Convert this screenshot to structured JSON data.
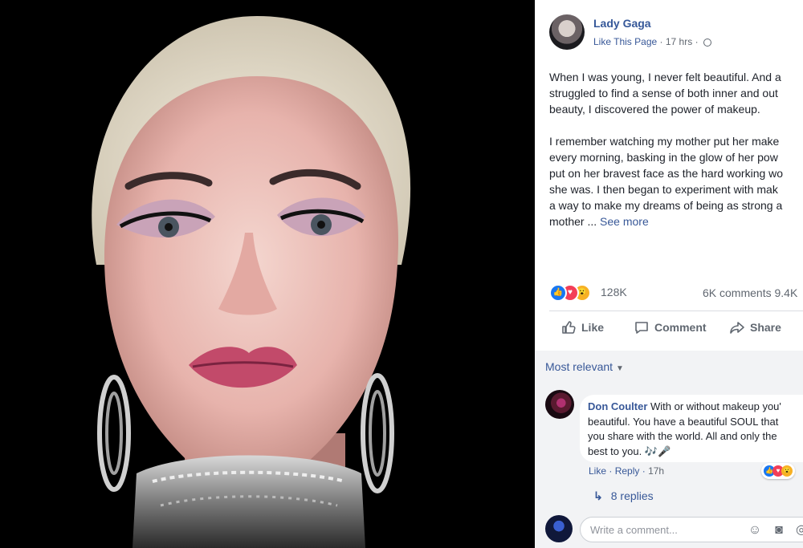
{
  "post": {
    "page_name": "Lady Gaga",
    "like_page": "Like This Page",
    "time": "17 hrs",
    "text_lines_1": [
      "When I was young, I never felt beautiful. And a",
      "struggled to find a sense of both inner and out",
      "beauty, I discovered the power of makeup."
    ],
    "text_lines_2": [
      "I remember watching my mother put her make",
      "every morning, basking in the glow of her pow",
      "put on her bravest face as the hard working wo",
      "she was. I then began to experiment with mak",
      "a way to make my dreams of being as strong a"
    ],
    "text_last_line": "mother ... ",
    "see_more": "See more",
    "reaction_count": "128K",
    "comments_shares": "6K comments  9.4K",
    "actions": {
      "like": "Like",
      "comment": "Comment",
      "share": "Share"
    }
  },
  "comments": {
    "sort_label": "Most relevant",
    "items": [
      {
        "author": "Don Coulter",
        "text_line_1": " With or without makeup you'",
        "text_line_2": "beautiful. You have a beautiful SOUL that",
        "text_line_3": "you share with the world. All and only the",
        "text_line_4": "best to you. 🎶🎤",
        "like": "Like",
        "reply": "Reply",
        "time": "17h",
        "replies": "8 replies"
      }
    ],
    "write_placeholder": "Write a comment..."
  },
  "colors": {
    "link": "#385898",
    "like_reaction": "#1877f2",
    "love_reaction": "#f33e58",
    "wow_reaction": "#f7b125"
  },
  "icons": [
    "globe-icon",
    "like-reaction-icon",
    "love-reaction-icon",
    "wow-reaction-icon",
    "thumbs-up-icon",
    "comment-icon",
    "share-icon",
    "caret-down-icon",
    "reply-arrow-icon",
    "emoji-icon",
    "camera-icon"
  ]
}
